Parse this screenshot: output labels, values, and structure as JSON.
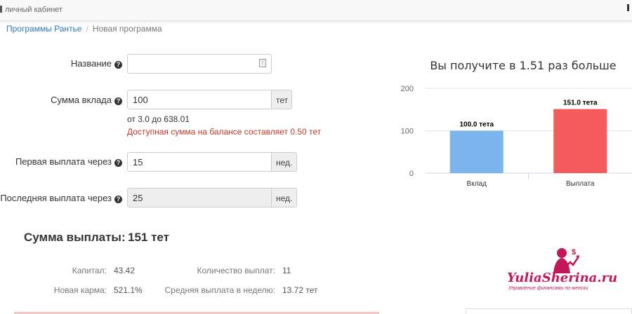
{
  "header": {
    "title": "личный кабинет"
  },
  "breadcrumb": {
    "root": "Программы Рантье",
    "separator": "/",
    "current": "Новая программа"
  },
  "form": {
    "name_label": "Название",
    "name_value": "",
    "deposit_label": "Сумма вклада",
    "deposit_value": "100",
    "deposit_unit": "тет",
    "deposit_range": "от 3.0 до 638.01",
    "deposit_warning": "Доступная сумма на балансе составляет 0.50 тет",
    "first_payout_label": "Первая выплата через",
    "first_payout_value": "15",
    "first_payout_unit": "нед.",
    "last_payout_label": "Последняя выплата через",
    "last_payout_value": "25",
    "last_payout_unit": "нед."
  },
  "summary": {
    "total_label": "Сумма выплаты:",
    "total_value": "151 тет",
    "capital_label": "Капитал:",
    "capital_value": "43.42",
    "karma_label": "Новая карма:",
    "karma_value": "521.1%",
    "count_label": "Количество выплат:",
    "count_value": "11",
    "avg_label": "Средняя выплата в неделю:",
    "avg_value": "13.72 тет"
  },
  "chart_data": {
    "type": "bar",
    "title": "Вы получите в 1.51 раз больше",
    "categories": [
      "Вклад",
      "Выплата"
    ],
    "values": [
      100.0,
      151.0
    ],
    "data_labels": [
      "100.0 тета",
      "151.0 тета"
    ],
    "colors": [
      "#7cb5ec",
      "#f45b5b"
    ],
    "ylim": [
      0,
      200
    ],
    "yticks": [
      "0",
      "100",
      "200"
    ],
    "grid": true
  },
  "watermark": {
    "brand": "YuliaSherina.ru",
    "tagline": "Управление финансами по-женски"
  }
}
